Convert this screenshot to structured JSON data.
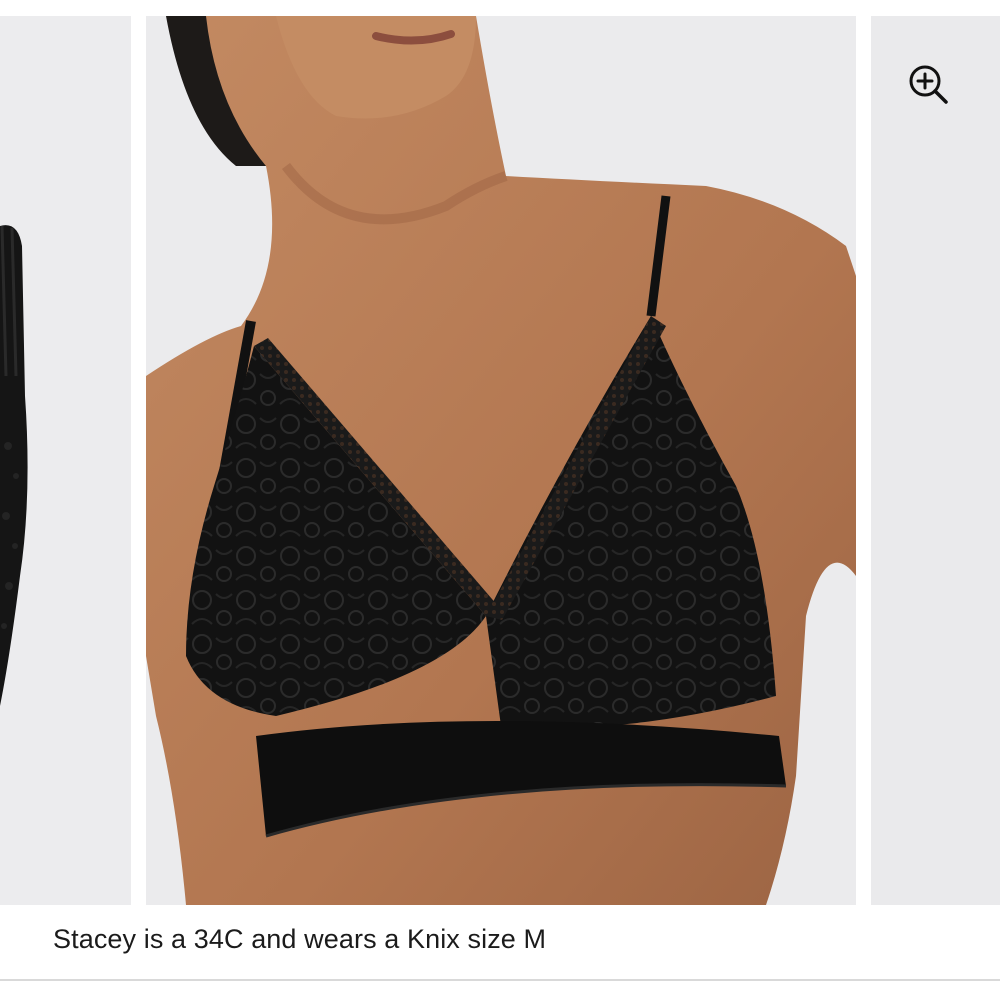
{
  "gallery": {
    "caption": "Stacey is a 34C and wears a Knix size M",
    "zoom_icon": "zoom-in-icon",
    "colors": {
      "background": "#ebebed",
      "product": "#111111",
      "skin": "#b57a55",
      "text": "#1b1b1b"
    }
  }
}
